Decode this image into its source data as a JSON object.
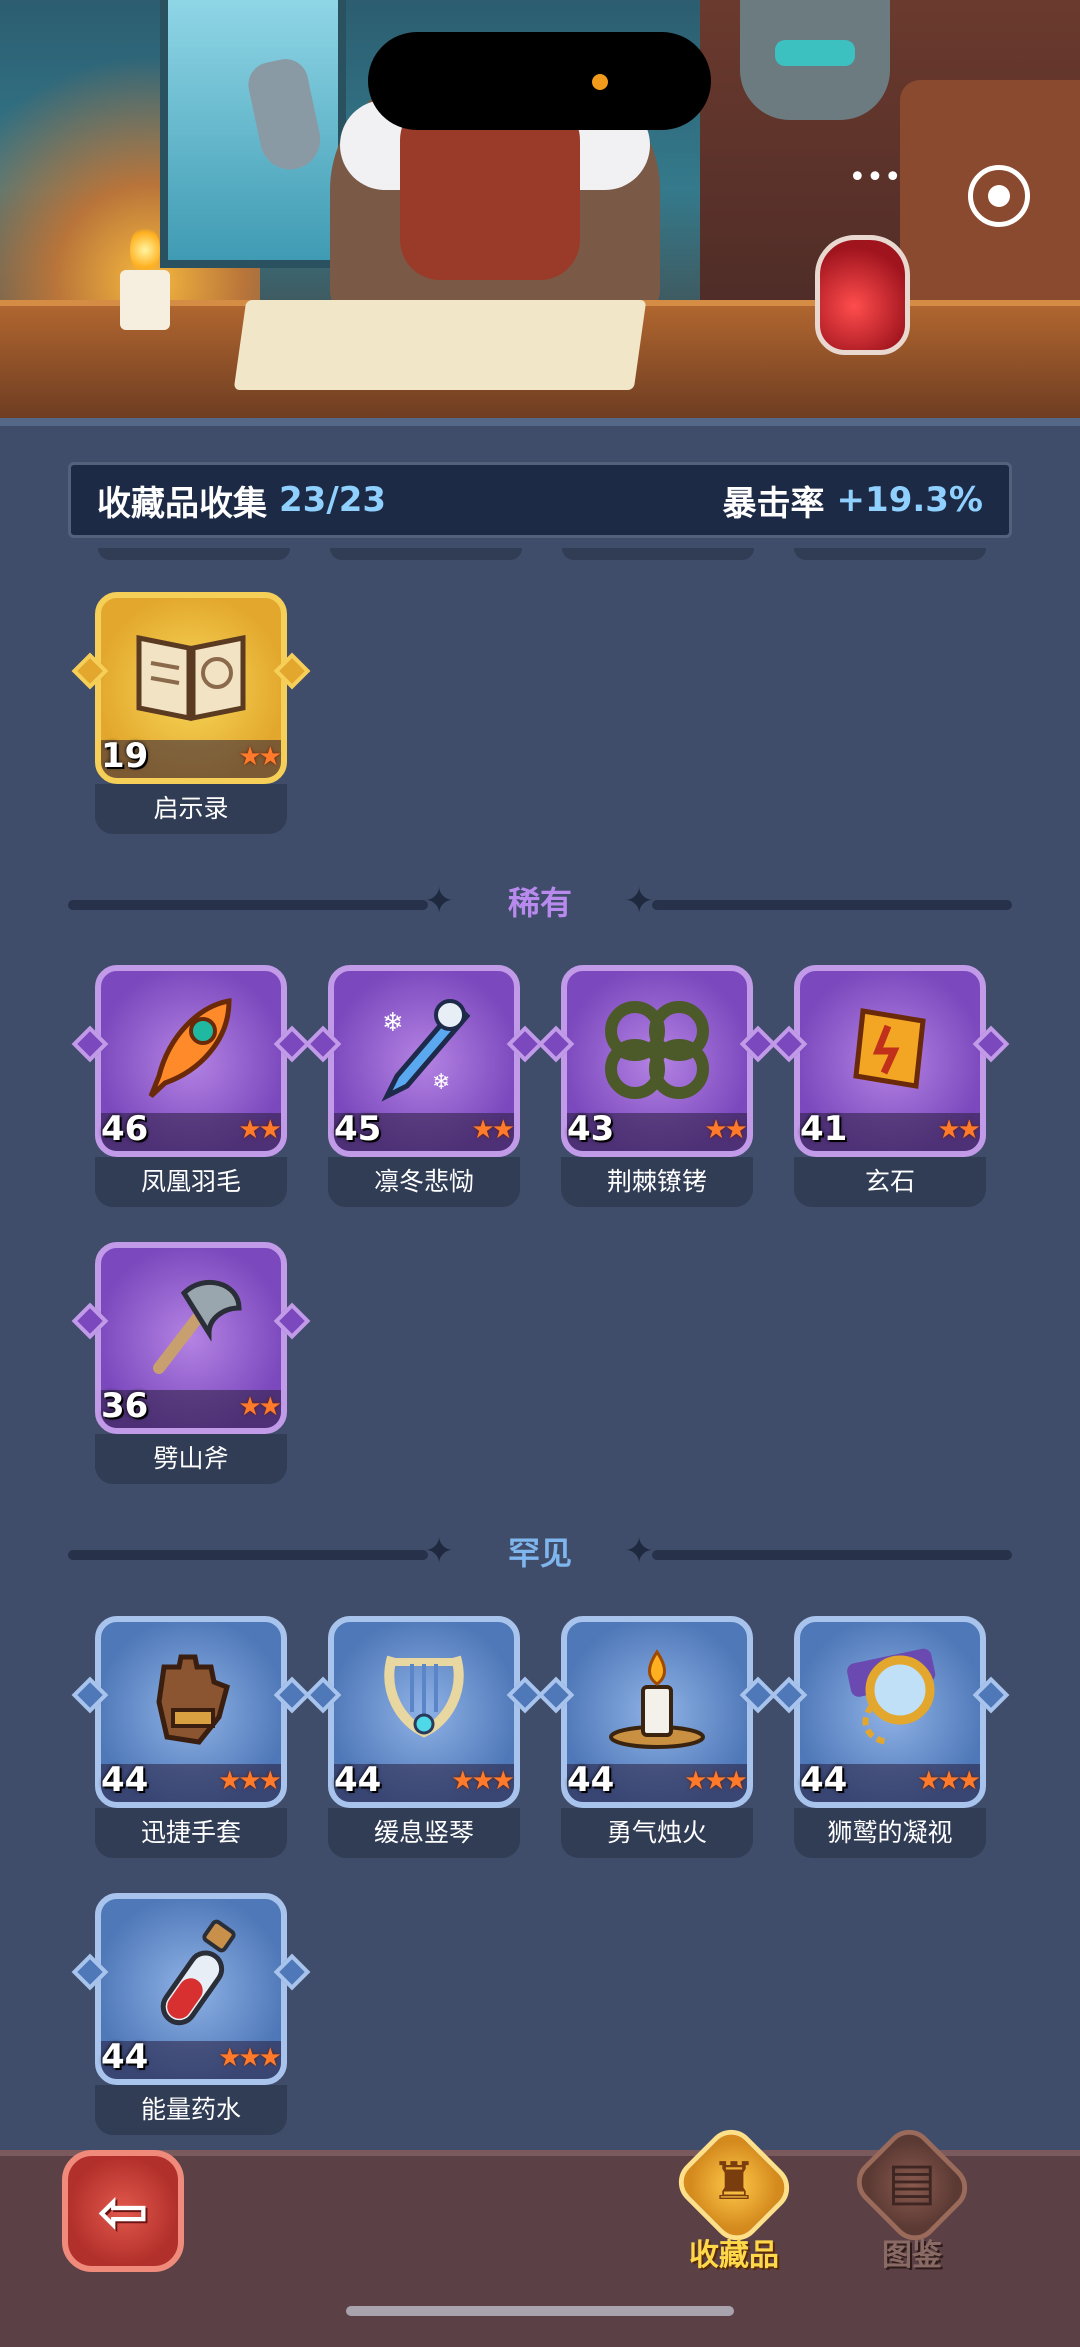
{
  "header": {
    "title": "收藏品收集",
    "progress": "23/23",
    "crit_label": "暴击率",
    "crit_value": "+19.3%"
  },
  "sections": {
    "epic_label": "稀有",
    "rare_label": "罕见"
  },
  "colors": {
    "epic_label": "#b98aee",
    "rare_label": "#7fb6ee",
    "legend_frame": "#f6cf58",
    "epic_frame": "#c19ae8",
    "rare_frame": "#a9c4ec",
    "active_tab": "#ffd84a"
  },
  "legendary_items": [
    {
      "name": "启示录",
      "level": "19",
      "stars": "★★",
      "icon": "book-icon"
    }
  ],
  "epic_items": [
    {
      "name": "凤凰羽毛",
      "level": "46",
      "stars": "★★",
      "icon": "feather-icon"
    },
    {
      "name": "凛冬悲恸",
      "level": "45",
      "stars": "★★",
      "icon": "frost-sword-icon"
    },
    {
      "name": "荆棘镣铐",
      "level": "43",
      "stars": "★★",
      "icon": "thorn-shackles-icon"
    },
    {
      "name": "玄石",
      "level": "41",
      "stars": "★★",
      "icon": "rune-stone-icon"
    },
    {
      "name": "劈山斧",
      "level": "36",
      "stars": "★★",
      "icon": "axe-icon"
    }
  ],
  "rare_items": [
    {
      "name": "迅捷手套",
      "level": "44",
      "stars": "★★★",
      "icon": "glove-icon"
    },
    {
      "name": "缓息竖琴",
      "level": "44",
      "stars": "★★★",
      "icon": "harp-icon"
    },
    {
      "name": "勇气烛火",
      "level": "44",
      "stars": "★★★",
      "icon": "candle-icon"
    },
    {
      "name": "狮鹫的凝视",
      "level": "44",
      "stars": "★★★",
      "icon": "monocle-icon"
    },
    {
      "name": "能量药水",
      "level": "44",
      "stars": "★★★",
      "icon": "potion-icon"
    }
  ],
  "nav": {
    "back_glyph": "⇦",
    "tab_collection": "收藏品",
    "tab_codex": "图鉴"
  },
  "miniapp": {
    "more_glyph": "•••"
  }
}
